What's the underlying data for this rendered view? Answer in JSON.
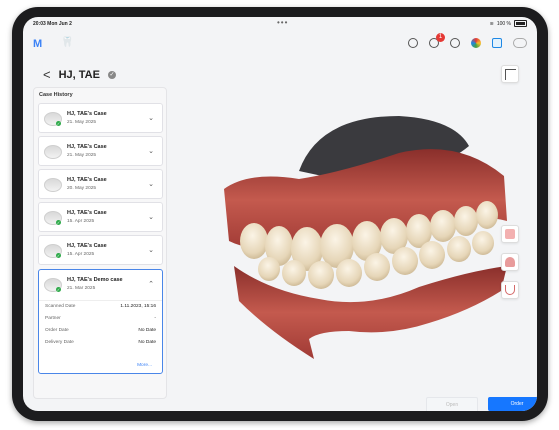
{
  "status_bar": {
    "time": "20:03 Mon Jun 2",
    "dots": "•••",
    "battery": "100 %"
  },
  "top_bar": {
    "logo_icon": "m-logo-icon",
    "tooth_icon": "tooth-icon",
    "notification_count": "1",
    "icons": [
      "user-circle-icon",
      "bell-icon",
      "settings-icon",
      "color-wheel-icon",
      "monitor-icon",
      "toggle-icon"
    ]
  },
  "patient": {
    "back": "<",
    "name": "HJ, TAE"
  },
  "sidebar": {
    "title": "Case History",
    "cases": [
      {
        "title": "HJ, TAE's Case",
        "date": "21. May 2025",
        "checked": true
      },
      {
        "title": "HJ, TAE's Case",
        "date": "21. May 2025",
        "checked": false
      },
      {
        "title": "HJ, TAE's Case",
        "date": "20. May 2025",
        "checked": false
      },
      {
        "title": "HJ, TAE's Case",
        "date": "15. Apr 2025",
        "checked": true
      },
      {
        "title": "HJ, TAE's Case",
        "date": "15. Apr 2025",
        "checked": true
      }
    ],
    "active_case": {
      "title": "HJ, TAE's Demo case",
      "date": "21. Mar 2025",
      "details": [
        {
          "label": "Scanned Date",
          "value": "1.11.2023, 15:16"
        },
        {
          "label": "Partner",
          "value": "-"
        },
        {
          "label": "Order Date",
          "value": "No Date"
        },
        {
          "label": "Delivery Date",
          "value": "No Date"
        }
      ],
      "more": "More..."
    }
  },
  "right_tools": [
    "layers-icon",
    "upper-jaw-icon",
    "lower-jaw-icon",
    "arch-icon"
  ],
  "buttons": {
    "open": "Open",
    "order": "Order"
  },
  "colors": {
    "accent": "#1677ff",
    "success": "#2eaa4a",
    "badge": "#e53935"
  }
}
